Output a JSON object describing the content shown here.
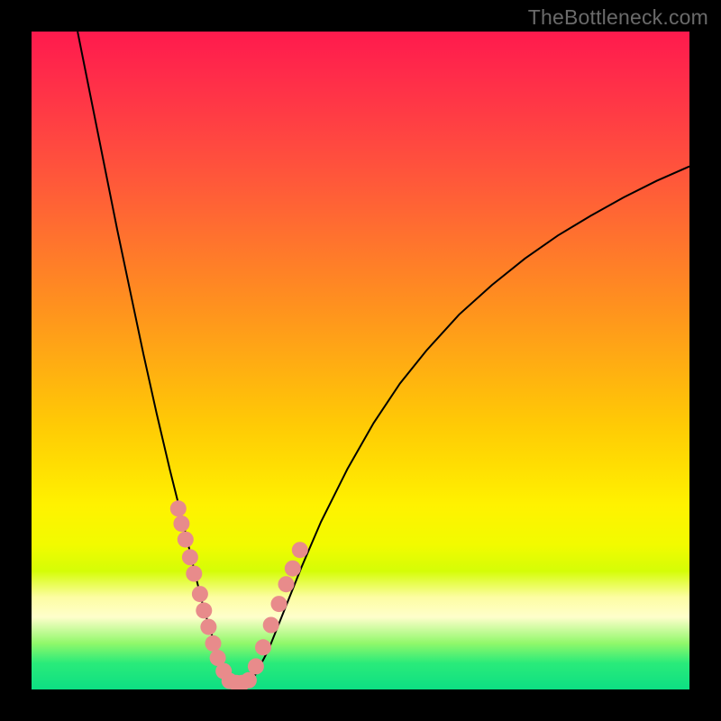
{
  "watermark": "TheBottleneck.com",
  "chart_data": {
    "type": "line",
    "title": "",
    "xlabel": "",
    "ylabel": "",
    "xlim": [
      0,
      1
    ],
    "ylim": [
      0,
      1
    ],
    "note": "Axes are unlabeled; values below are normalized [0,1] coordinates read off the plot area (origin at bottom-left).",
    "series": [
      {
        "name": "curve",
        "x": [
          0.07,
          0.09,
          0.11,
          0.13,
          0.15,
          0.17,
          0.19,
          0.21,
          0.23,
          0.25,
          0.26,
          0.27,
          0.28,
          0.29,
          0.3,
          0.31,
          0.32,
          0.33,
          0.34,
          0.36,
          0.38,
          0.41,
          0.44,
          0.48,
          0.52,
          0.56,
          0.6,
          0.65,
          0.7,
          0.75,
          0.8,
          0.85,
          0.9,
          0.95,
          1.0
        ],
        "y": [
          1.0,
          0.9,
          0.8,
          0.7,
          0.605,
          0.51,
          0.42,
          0.335,
          0.255,
          0.17,
          0.13,
          0.095,
          0.065,
          0.04,
          0.016,
          0.01,
          0.01,
          0.012,
          0.022,
          0.06,
          0.11,
          0.185,
          0.255,
          0.335,
          0.405,
          0.465,
          0.515,
          0.57,
          0.615,
          0.655,
          0.69,
          0.72,
          0.748,
          0.773,
          0.795
        ]
      }
    ],
    "markers": {
      "name": "dot-cluster",
      "color": "#e88b8b",
      "x": [
        0.223,
        0.228,
        0.234,
        0.241,
        0.247,
        0.256,
        0.262,
        0.269,
        0.276,
        0.283,
        0.292,
        0.301,
        0.311,
        0.32,
        0.33,
        0.341,
        0.352,
        0.364,
        0.376,
        0.387,
        0.397,
        0.408
      ],
      "y": [
        0.275,
        0.252,
        0.228,
        0.201,
        0.176,
        0.145,
        0.12,
        0.095,
        0.07,
        0.048,
        0.028,
        0.013,
        0.01,
        0.01,
        0.014,
        0.035,
        0.064,
        0.098,
        0.13,
        0.16,
        0.184,
        0.212
      ]
    }
  }
}
